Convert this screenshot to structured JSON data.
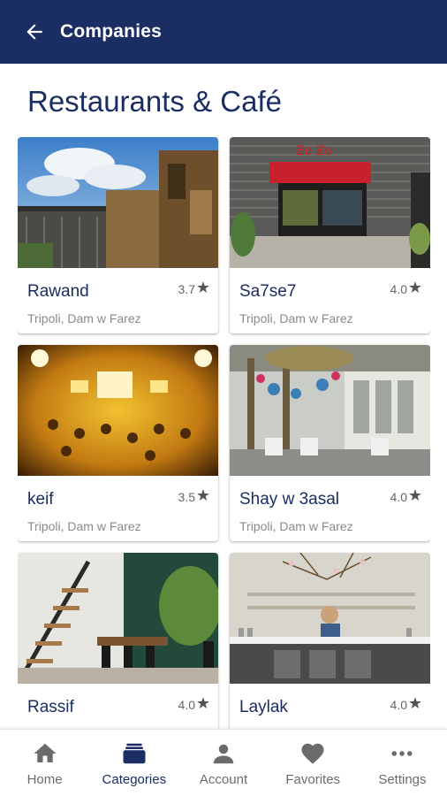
{
  "appbar": {
    "title": "Companies",
    "back_icon": "arrow-left-icon"
  },
  "section": {
    "title": "Restaurants & Café"
  },
  "cards": [
    {
      "name": "Rawand",
      "rating": "3.7",
      "location": "Tripoli, Dam w Farez"
    },
    {
      "name": "Sa7se7",
      "rating": "4.0",
      "location": "Tripoli, Dam w Farez"
    },
    {
      "name": "keif",
      "rating": "3.5",
      "location": "Tripoli, Dam w Farez"
    },
    {
      "name": "Shay w 3asal",
      "rating": "4.0",
      "location": "Tripoli, Dam w Farez"
    },
    {
      "name": "Rassif",
      "rating": "4.0",
      "location": ""
    },
    {
      "name": "Laylak",
      "rating": "4.0",
      "location": ""
    }
  ],
  "star_glyph": "★",
  "nav": [
    {
      "label": "Home",
      "icon": "home-icon"
    },
    {
      "label": "Categories",
      "icon": "categories-icon",
      "active": true
    },
    {
      "label": "Account",
      "icon": "account-icon"
    },
    {
      "label": "Favorites",
      "icon": "heart-icon"
    },
    {
      "label": "Settings",
      "icon": "more-icon"
    }
  ],
  "colors": {
    "primary": "#1a2e63",
    "nav_inactive": "#6b6b6b",
    "subtitle": "#8a8a8a"
  }
}
